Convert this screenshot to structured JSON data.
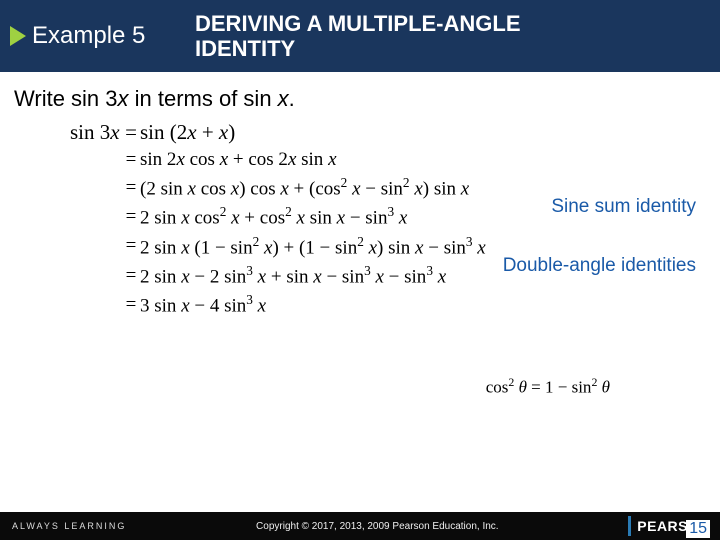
{
  "header": {
    "example_label": "Example 5",
    "title_line1": "DERIVING A MULTIPLE-ANGLE",
    "title_line2": "IDENTITY"
  },
  "prompt": {
    "pre": "Write sin 3",
    "var1": "x",
    "mid": " in terms of sin ",
    "var2": "x",
    "post": "."
  },
  "math": {
    "line1_lhs": "sin 3x",
    "line1_rhs": "sin (2x + x)",
    "line2": "sin 2x cos x + cos 2x sin x",
    "line3": "(2 sin x cos x) cos x + (cos² x − sin² x) sin x",
    "line4": "2 sin x cos² x + cos² x sin x − sin³ x",
    "line5": "2 sin x (1 − sin² x) + (1 − sin² x) sin x − sin³ x",
    "line6": "2 sin x − 2 sin³ x + sin x − sin³ x − sin³ x",
    "line7": "3 sin x − 4 sin³ x"
  },
  "annotations": {
    "a1": "Sine sum identity",
    "a2": "Double-angle identities",
    "sub": "cos² θ = 1 − sin² θ"
  },
  "footer": {
    "always": "ALWAYS LEARNING",
    "copyright": "Copyright © 2017, 2013, 2009 Pearson Education, Inc.",
    "brand": "PEARSON",
    "page": "15"
  }
}
